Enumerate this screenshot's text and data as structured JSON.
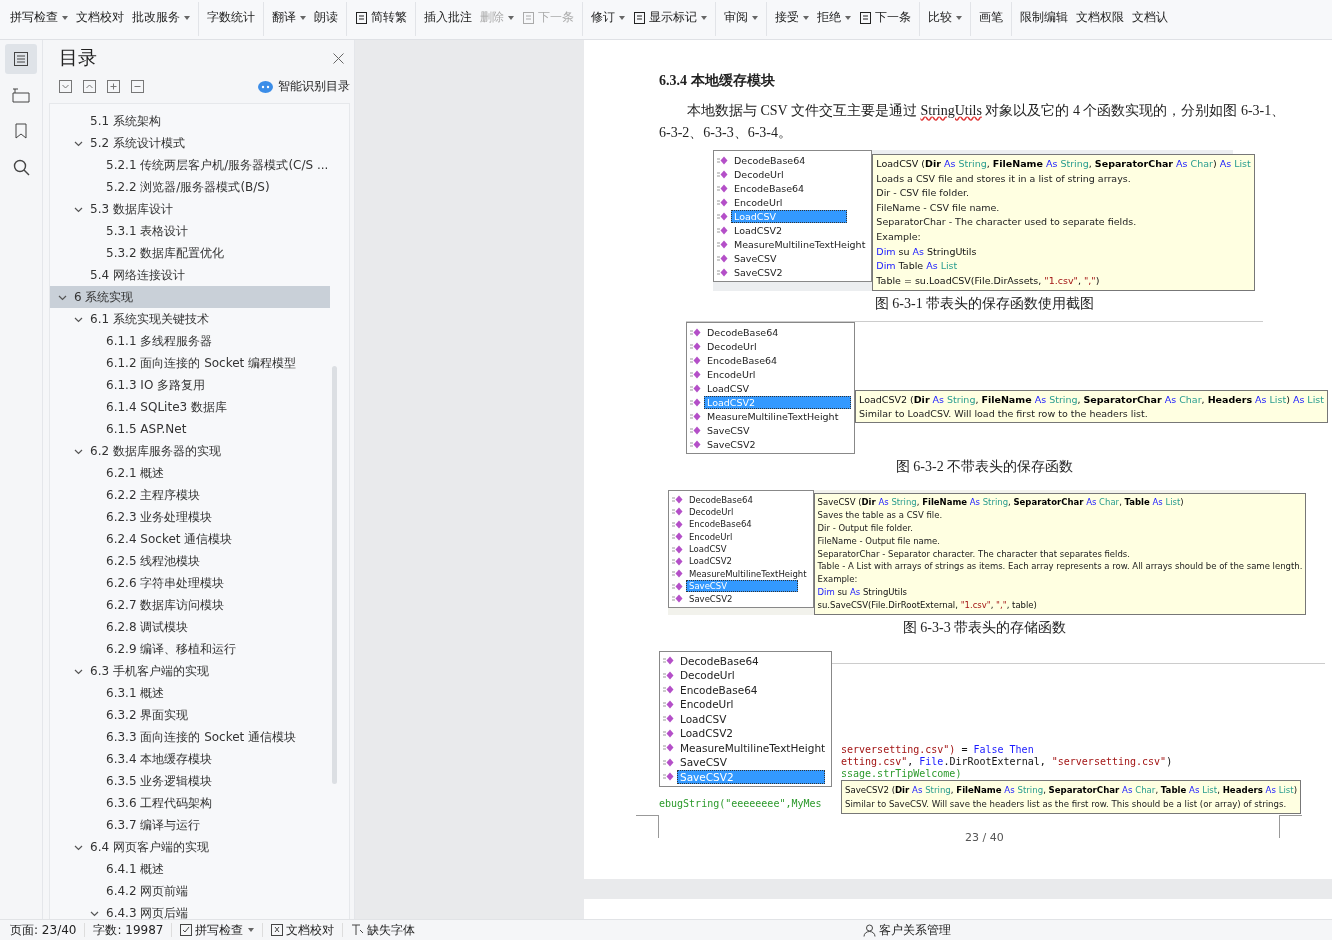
{
  "toolbar": {
    "groups": [
      [
        {
          "label": "拼写检查",
          "caret": true,
          "disabled": false,
          "kind": "stacked"
        },
        {
          "label": "文档校对",
          "caret": false,
          "disabled": false,
          "kind": "stacked"
        },
        {
          "label": "批改服务",
          "caret": true,
          "disabled": false,
          "kind": "stacked"
        }
      ],
      [
        {
          "label": "字数统计",
          "caret": false,
          "disabled": false,
          "kind": "stacked"
        }
      ],
      [
        {
          "label": "翻译",
          "caret": true,
          "disabled": false,
          "kind": "stacked"
        },
        {
          "label": "朗读",
          "caret": false,
          "disabled": false,
          "kind": "stacked"
        }
      ],
      [
        {
          "label": "简转繁",
          "caret": false,
          "disabled": false,
          "kind": "inline"
        }
      ],
      [
        {
          "label": "插入批注",
          "caret": false,
          "disabled": false,
          "kind": "stacked"
        },
        {
          "label": "删除",
          "caret": true,
          "disabled": true,
          "kind": "stacked"
        },
        {
          "label": "下一条",
          "caret": false,
          "disabled": true,
          "kind": "inline"
        }
      ],
      [
        {
          "label": "修订",
          "caret": true,
          "disabled": false,
          "kind": "stacked"
        },
        {
          "label": "显示标记",
          "caret": true,
          "disabled": false,
          "kind": "inline"
        }
      ],
      [
        {
          "label": "审阅",
          "caret": true,
          "disabled": false,
          "kind": "stacked"
        }
      ],
      [
        {
          "label": "接受",
          "caret": true,
          "disabled": false,
          "kind": "stacked"
        },
        {
          "label": "拒绝",
          "caret": true,
          "disabled": false,
          "kind": "stacked"
        },
        {
          "label": "下一条",
          "caret": false,
          "disabled": false,
          "kind": "inline"
        }
      ],
      [
        {
          "label": "比较",
          "caret": true,
          "disabled": false,
          "kind": "stacked"
        }
      ],
      [
        {
          "label": "画笔",
          "caret": false,
          "disabled": false,
          "kind": "stacked"
        }
      ],
      [
        {
          "label": "限制编辑",
          "caret": false,
          "disabled": false,
          "kind": "stacked"
        },
        {
          "label": "文档权限",
          "caret": false,
          "disabled": false,
          "kind": "stacked"
        },
        {
          "label": "文档认",
          "caret": false,
          "disabled": false,
          "kind": "stacked"
        }
      ]
    ]
  },
  "rail": [
    {
      "kind": "contents",
      "selected": true
    },
    {
      "kind": "outline",
      "selected": false
    },
    {
      "kind": "bookmark",
      "selected": false
    },
    {
      "kind": "search",
      "selected": false
    }
  ],
  "toc": {
    "title": "目录",
    "smart_link": "智能识别目录",
    "items": [
      {
        "children": [
          {
            "label": "5.1 系统架构",
            "selected": false
          },
          {
            "label": "5.2 系统设计模式",
            "selected": false,
            "expanded": true,
            "children": [
              {
                "label": "5.2.1 传统两层客户机/服务器模式(C/S ...",
                "selected": false
              },
              {
                "label": "5.2.2 浏览器/服务器模式(B/S)",
                "selected": false
              }
            ]
          },
          {
            "label": "5.3 数据库设计",
            "selected": false,
            "expanded": true,
            "children": [
              {
                "label": "5.3.1 表格设计",
                "selected": false
              },
              {
                "label": "5.3.2 数据库配置优化",
                "selected": false
              }
            ]
          },
          {
            "label": "5.4 网络连接设计",
            "selected": false
          }
        ]
      },
      {
        "label": "6  系统实现",
        "selected": true,
        "expanded": true,
        "children": [
          {
            "label": "6.1  系统实现关键技术",
            "selected": false,
            "expanded": true,
            "children": [
              {
                "label": "6.1.1 多线程服务器",
                "selected": false
              },
              {
                "label": "6.1.2 面向连接的 Socket 编程模型",
                "selected": false
              },
              {
                "label": "6.1.3 IO 多路复用",
                "selected": false
              },
              {
                "label": "6.1.4 SQLite3 数据库",
                "selected": false
              },
              {
                "label": "6.1.5 ASP.Net",
                "selected": false
              }
            ]
          },
          {
            "label": "6.2 数据库服务器的实现",
            "selected": false,
            "expanded": true,
            "children": [
              {
                "label": "6.2.1 概述",
                "selected": false
              },
              {
                "label": "6.2.2 主程序模块",
                "selected": false
              },
              {
                "label": "6.2.3 业务处理模块",
                "selected": false
              },
              {
                "label": "6.2.4 Socket 通信模块",
                "selected": false
              },
              {
                "label": "6.2.5 线程池模块",
                "selected": false
              },
              {
                "label": "6.2.6 字符串处理模块",
                "selected": false
              },
              {
                "label": "6.2.7 数据库访问模块",
                "selected": false
              },
              {
                "label": "6.2.8 调试模块",
                "selected": false
              },
              {
                "label": "6.2.9  编译、移植和运行",
                "selected": false
              }
            ]
          },
          {
            "label": "6.3 手机客户端的实现",
            "selected": false,
            "expanded": true,
            "children": [
              {
                "label": "6.3.1 概述",
                "selected": false
              },
              {
                "label": "6.3.2 界面实现",
                "selected": false
              },
              {
                "label": "6.3.3 面向连接的 Socket 通信模块",
                "selected": false
              },
              {
                "label": "6.3.4 本地缓存模块",
                "selected": false
              },
              {
                "label": "6.3.5 业务逻辑模块",
                "selected": false
              },
              {
                "label": "6.3.6 工程代码架构",
                "selected": false
              },
              {
                "label": "6.3.7 编译与运行",
                "selected": false
              }
            ]
          },
          {
            "label": "6.4 网页客户端的实现",
            "selected": false,
            "expanded": true,
            "children": [
              {
                "label": "6.4.1 概述",
                "selected": false
              },
              {
                "label": "6.4.2 网页前端",
                "selected": false
              },
              {
                "label": "6.4.3 网页后端",
                "selected": false,
                "expanded": true
              }
            ]
          }
        ]
      }
    ]
  },
  "document": {
    "heading": "6.3.4 本地缓存模块",
    "paragraph": {
      "before": "本地数据与 CSV 文件交互主要是通过 ",
      "misspelled": "StringUtils",
      "after": " 对象以及它的 4 个函数实现的，分别如图 6-3-1、6-3-2、6-3-3、6-3-4。"
    },
    "figures": [
      {
        "kind": "top",
        "caption": "图 6-3-1 带表头的保存函数使用截图",
        "members": [
          {
            "name": "DecodeBase64",
            "selected": false
          },
          {
            "name": "DecodeUrl",
            "selected": false
          },
          {
            "name": "EncodeBase64",
            "selected": false
          },
          {
            "name": "EncodeUrl",
            "selected": false
          },
          {
            "name": "LoadCSV",
            "selected": true
          },
          {
            "name": "LoadCSV2",
            "selected": false
          },
          {
            "name": "MeasureMultilineTextHeight",
            "selected": false
          },
          {
            "name": "SaveCSV",
            "selected": false
          },
          {
            "name": "SaveCSV2",
            "selected": false
          }
        ],
        "tooltip": [
          {
            "parts": [
              {
                "text": "LoadCSV (",
                "kind": "plain"
              },
              {
                "text": "Dir",
                "kind": "param"
              },
              {
                "text": " As ",
                "kind": "keyword"
              },
              {
                "text": "String",
                "kind": "type"
              },
              {
                "text": ", ",
                "kind": "plain"
              },
              {
                "text": "FileName",
                "kind": "param"
              },
              {
                "text": " As ",
                "kind": "keyword"
              },
              {
                "text": "String",
                "kind": "type"
              },
              {
                "text": ", ",
                "kind": "plain"
              },
              {
                "text": "SeparatorChar",
                "kind": "param"
              },
              {
                "text": " As ",
                "kind": "keyword"
              },
              {
                "text": "Char",
                "kind": "type"
              },
              {
                "text": ") ",
                "kind": "plain"
              },
              {
                "text": "As ",
                "kind": "keyword"
              },
              {
                "text": "List",
                "kind": "type"
              }
            ]
          },
          {
            "text": "Loads a CSV file and stores it in a list of string arrays."
          },
          {
            "text": "Dir - CSV file folder."
          },
          {
            "text": "FileName - CSV file name."
          },
          {
            "text": "SeparatorChar - The character used to separate fields."
          },
          {
            "text": "Example:"
          },
          {
            "parts": [
              {
                "text": "Dim",
                "kind": "keyword"
              },
              {
                "text": " su ",
                "kind": "plain"
              },
              {
                "text": "As",
                "kind": "keyword"
              },
              {
                "text": " StringUtils",
                "kind": "plain"
              }
            ]
          },
          {
            "parts": [
              {
                "text": "Dim",
                "kind": "keyword"
              },
              {
                "text": " Table ",
                "kind": "plain"
              },
              {
                "text": "As ",
                "kind": "keyword"
              },
              {
                "text": "List",
                "kind": "type"
              }
            ]
          },
          {
            "parts": [
              {
                "text": "Table = su.LoadCSV(File.DirAssets, ",
                "kind": "plain"
              },
              {
                "text": "\"1.csv\"",
                "kind": "string"
              },
              {
                "text": ", ",
                "kind": "plain"
              },
              {
                "text": "\",\"",
                "kind": "string"
              },
              {
                "text": ")",
                "kind": "plain"
              }
            ]
          }
        ]
      },
      {
        "kind": "row",
        "caption": "图 6-3-2 不带表头的保存函数",
        "members": [
          {
            "name": "DecodeBase64",
            "selected": false
          },
          {
            "name": "DecodeUrl",
            "selected": false
          },
          {
            "name": "EncodeBase64",
            "selected": false
          },
          {
            "name": "EncodeUrl",
            "selected": false
          },
          {
            "name": "LoadCSV",
            "selected": false
          },
          {
            "name": "LoadCSV2",
            "selected": true
          },
          {
            "name": "MeasureMultilineTextHeight",
            "selected": false
          },
          {
            "name": "SaveCSV",
            "selected": false
          },
          {
            "name": "SaveCSV2",
            "selected": false
          }
        ],
        "tooltip": [
          {
            "parts": [
              {
                "text": "LoadCSV2 (",
                "kind": "plain"
              },
              {
                "text": "Dir",
                "kind": "param"
              },
              {
                "text": " As ",
                "kind": "keyword"
              },
              {
                "text": "String",
                "kind": "type"
              },
              {
                "text": ", ",
                "kind": "plain"
              },
              {
                "text": "FileName",
                "kind": "param"
              },
              {
                "text": " As ",
                "kind": "keyword"
              },
              {
                "text": "String",
                "kind": "type"
              },
              {
                "text": ", ",
                "kind": "plain"
              },
              {
                "text": "SeparatorChar",
                "kind": "param"
              },
              {
                "text": " As ",
                "kind": "keyword"
              },
              {
                "text": "Char",
                "kind": "type"
              },
              {
                "text": ", ",
                "kind": "plain"
              },
              {
                "text": "Headers",
                "kind": "param"
              },
              {
                "text": " As ",
                "kind": "keyword"
              },
              {
                "text": "List",
                "kind": "type"
              },
              {
                "text": ") ",
                "kind": "plain"
              },
              {
                "text": "As ",
                "kind": "keyword"
              },
              {
                "text": "List",
                "kind": "type"
              }
            ]
          },
          {
            "text": "Similar to LoadCSV. Will load the first row to the headers list."
          }
        ]
      },
      {
        "kind": "top",
        "caption": "图 6-3-3 带表头的存储函数",
        "members": [
          {
            "name": "DecodeBase64",
            "selected": false
          },
          {
            "name": "DecodeUrl",
            "selected": false
          },
          {
            "name": "EncodeBase64",
            "selected": false
          },
          {
            "name": "EncodeUrl",
            "selected": false
          },
          {
            "name": "LoadCSV",
            "selected": false
          },
          {
            "name": "LoadCSV2",
            "selected": false
          },
          {
            "name": "MeasureMultilineTextHeight",
            "selected": false
          },
          {
            "name": "SaveCSV",
            "selected": true
          },
          {
            "name": "SaveCSV2",
            "selected": false
          }
        ],
        "tooltip": [
          {
            "parts": [
              {
                "text": "SaveCSV (",
                "kind": "plain"
              },
              {
                "text": "Dir",
                "kind": "param"
              },
              {
                "text": " As ",
                "kind": "keyword"
              },
              {
                "text": "String",
                "kind": "type"
              },
              {
                "text": ", ",
                "kind": "plain"
              },
              {
                "text": "FileName",
                "kind": "param"
              },
              {
                "text": " As ",
                "kind": "keyword"
              },
              {
                "text": "String",
                "kind": "type"
              },
              {
                "text": ", ",
                "kind": "plain"
              },
              {
                "text": "SeparatorChar",
                "kind": "param"
              },
              {
                "text": " As ",
                "kind": "keyword"
              },
              {
                "text": "Char",
                "kind": "type"
              },
              {
                "text": ", ",
                "kind": "plain"
              },
              {
                "text": "Table",
                "kind": "param"
              },
              {
                "text": " As ",
                "kind": "keyword"
              },
              {
                "text": "List",
                "kind": "type"
              },
              {
                "text": ")",
                "kind": "plain"
              }
            ]
          },
          {
            "text": "Saves the table as a CSV file."
          },
          {
            "text": "Dir - Output file folder."
          },
          {
            "text": "FileName - Output file name."
          },
          {
            "text": "SeparatorChar - Separator character. The character that separates fields."
          },
          {
            "text": "Table - A List with arrays of strings as items. Each array represents a row. All arrays should be of the same length."
          },
          {
            "text": "Example:"
          },
          {
            "parts": [
              {
                "text": "Dim",
                "kind": "keyword"
              },
              {
                "text": " su ",
                "kind": "plain"
              },
              {
                "text": "As",
                "kind": "keyword"
              },
              {
                "text": " StringUtils",
                "kind": "plain"
              }
            ]
          },
          {
            "parts": [
              {
                "text": "su.SaveCSV(File.DirRootExternal, ",
                "kind": "plain"
              },
              {
                "text": "\"1.csv\"",
                "kind": "string"
              },
              {
                "text": ", ",
                "kind": "plain"
              },
              {
                "text": "\",\"",
                "kind": "string"
              },
              {
                "text": ", table)",
                "kind": "plain"
              }
            ]
          }
        ]
      },
      {
        "kind": "code",
        "members": [
          {
            "name": "DecodeBase64",
            "selected": false
          },
          {
            "name": "DecodeUrl",
            "selected": false
          },
          {
            "name": "EncodeBase64",
            "selected": false
          },
          {
            "name": "EncodeUrl",
            "selected": false
          },
          {
            "name": "LoadCSV",
            "selected": false
          },
          {
            "name": "LoadCSV2",
            "selected": false
          },
          {
            "name": "MeasureMultilineTextHeight",
            "selected": false
          },
          {
            "name": "SaveCSV",
            "selected": false
          },
          {
            "name": "SaveCSV2",
            "selected": true
          }
        ],
        "code": [
          {
            "parts": [
              {
                "text": "serversetting.csv\")",
                "kind": "string"
              },
              {
                "text": " = ",
                "kind": "plain"
              },
              {
                "text": "False  Then",
                "kind": "keyword"
              }
            ]
          },
          {
            "parts": [
              {
                "text": "etting.csv\"",
                "kind": "string"
              },
              {
                "text": ", ",
                "kind": "plain"
              },
              {
                "text": "File",
                "kind": "keyword"
              },
              {
                "text": ".DirRootExternal, ",
                "kind": "plain"
              },
              {
                "text": "\"serversetting.csv\"",
                "kind": "string"
              },
              {
                "text": ")",
                "kind": "plain"
              }
            ]
          },
          {
            "parts": [
              {
                "text": "ssage.strTipWelcome)",
                "kind": "green"
              }
            ]
          }
        ],
        "code_tail": {
          "parts": [
            {
              "text": "ebugString(\"eeeeeeee\",MyMes",
              "kind": "green"
            }
          ]
        },
        "tooltip": [
          {
            "parts": [
              {
                "text": "SaveCSV2 (",
                "kind": "plain"
              },
              {
                "text": "Dir",
                "kind": "param"
              },
              {
                "text": " As ",
                "kind": "keyword"
              },
              {
                "text": "String",
                "kind": "type"
              },
              {
                "text": ", ",
                "kind": "plain"
              },
              {
                "text": "FileName",
                "kind": "param"
              },
              {
                "text": " As ",
                "kind": "keyword"
              },
              {
                "text": "String",
                "kind": "type"
              },
              {
                "text": ", ",
                "kind": "plain"
              },
              {
                "text": "SeparatorChar",
                "kind": "param"
              },
              {
                "text": " As ",
                "kind": "keyword"
              },
              {
                "text": "Char",
                "kind": "type"
              },
              {
                "text": ", ",
                "kind": "plain"
              },
              {
                "text": "Table",
                "kind": "param"
              },
              {
                "text": " As ",
                "kind": "keyword"
              },
              {
                "text": "List",
                "kind": "type"
              },
              {
                "text": ", ",
                "kind": "plain"
              },
              {
                "text": "Headers",
                "kind": "param"
              },
              {
                "text": " As ",
                "kind": "keyword"
              },
              {
                "text": "List",
                "kind": "type"
              },
              {
                "text": ")",
                "kind": "plain"
              }
            ]
          },
          {
            "text": "Similar to SaveCSV. Will save the headers list as the first row. This should be a list (or array) of strings."
          }
        ]
      }
    ],
    "page_number": "23 / 40"
  },
  "status_bar": {
    "page": "页面: 23/40",
    "words": "字数: 19987",
    "spell": {
      "label": "拼写检查",
      "caret": true
    },
    "proof": "文档校对",
    "fonts": "缺失字体",
    "app": "客户关系管理"
  }
}
